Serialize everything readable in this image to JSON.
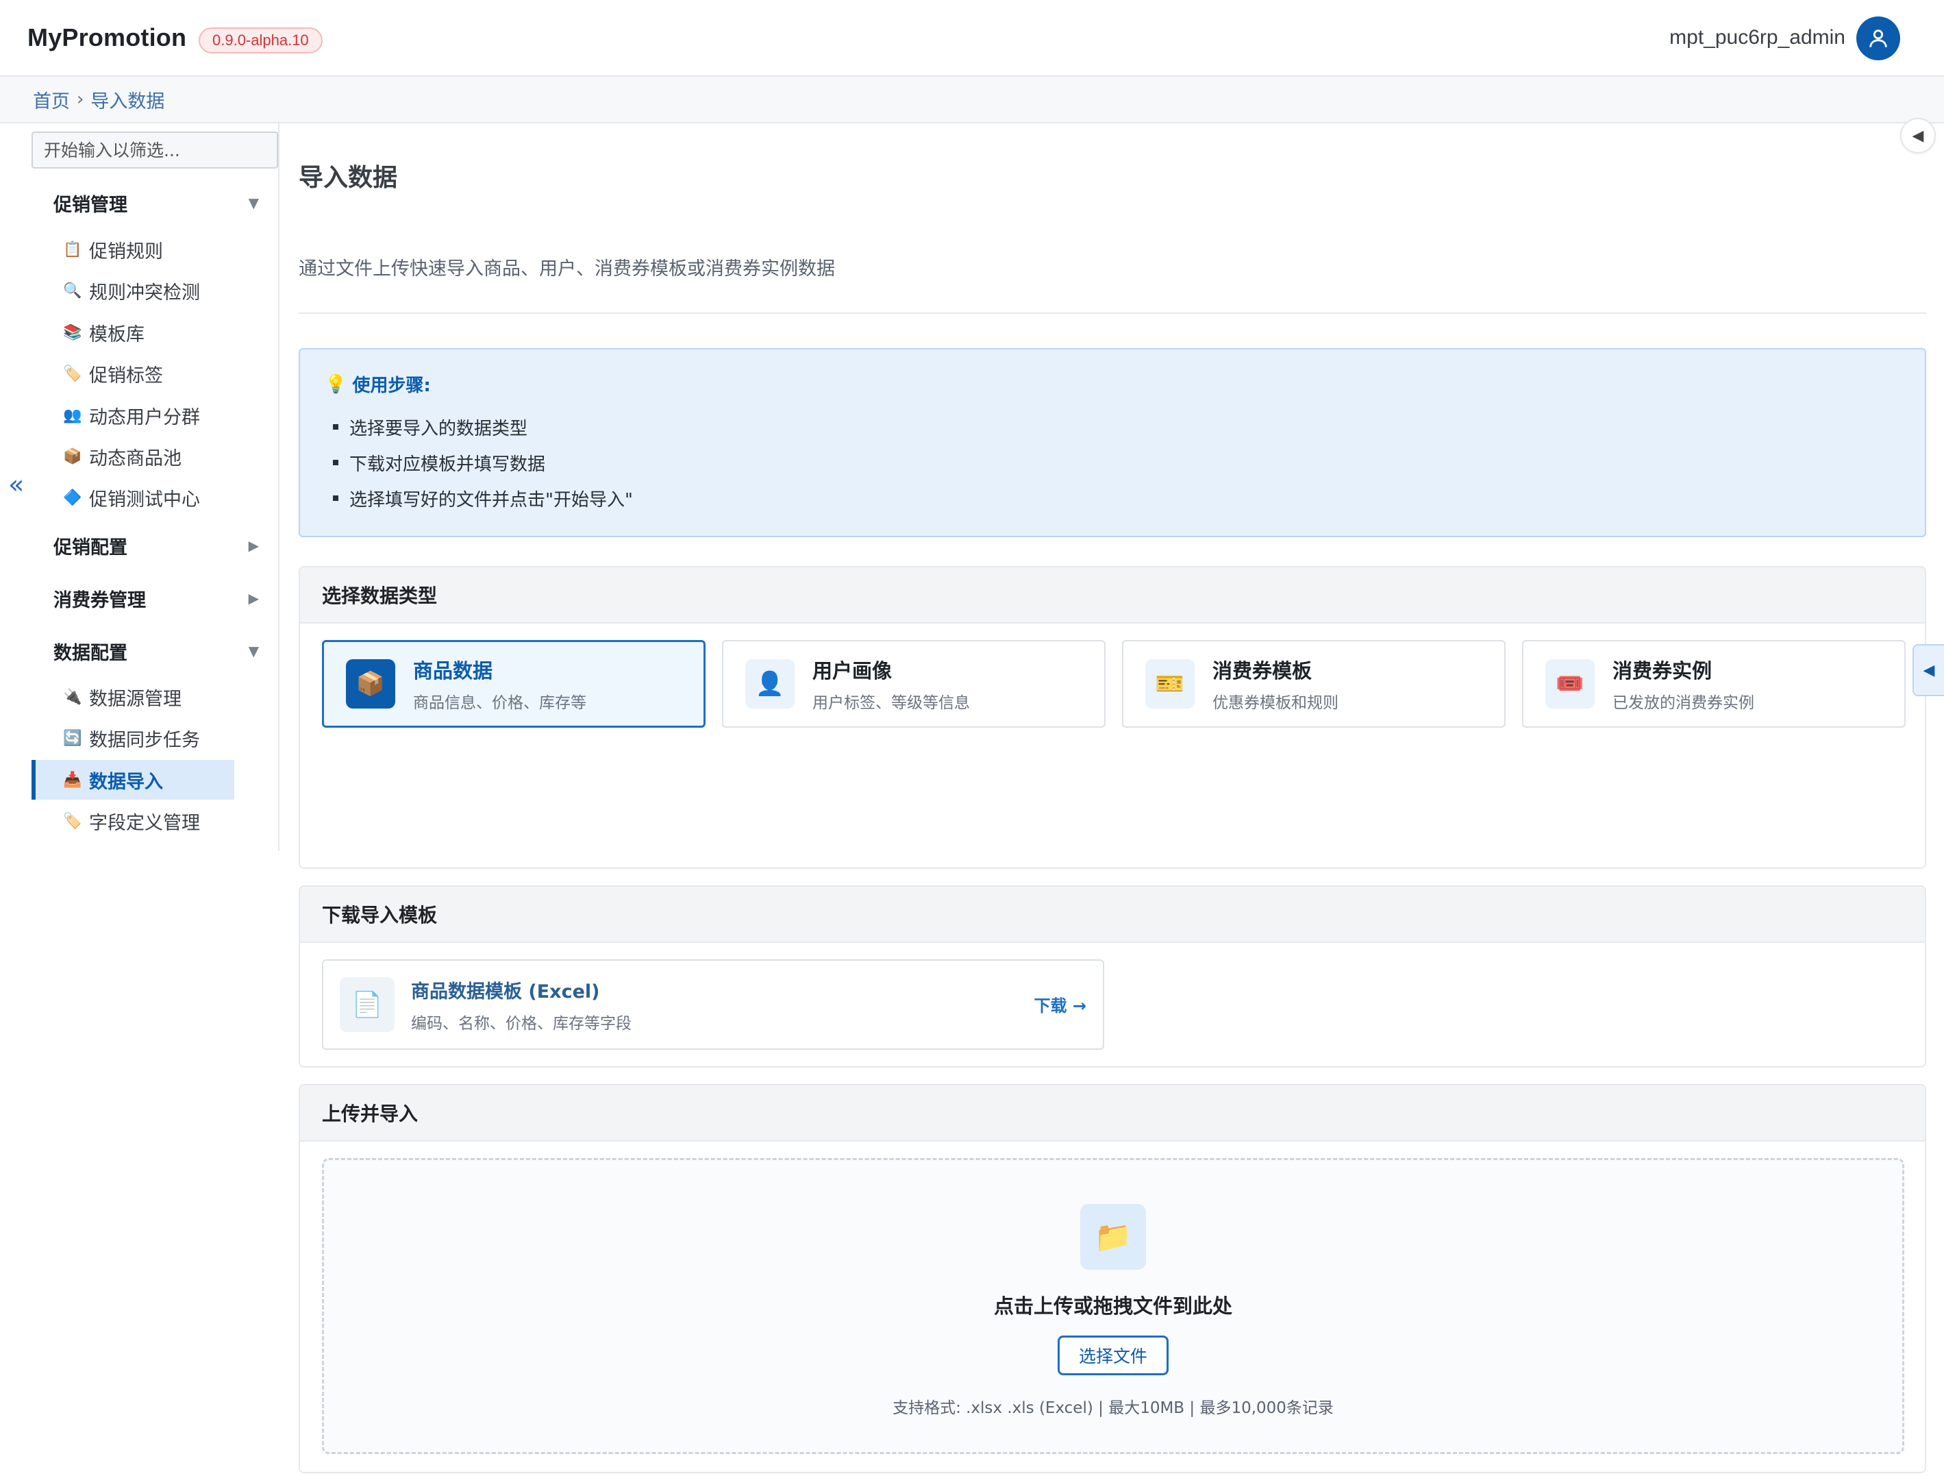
{
  "app": {
    "brand": "MyPromotion",
    "version": "0.9.0-alpha.10",
    "username": "mpt_puc6rp_admin"
  },
  "breadcrumb": {
    "home": "首页",
    "separator": "›",
    "current": "导入数据"
  },
  "sidebar": {
    "filter_placeholder": "开始输入以筛选...",
    "collapse_icon": "«",
    "groups": [
      {
        "title": "促销管理",
        "expanded": true,
        "items": [
          {
            "icon": "📋",
            "label": "促销规则"
          },
          {
            "icon": "🔍",
            "label": "规则冲突检测"
          },
          {
            "icon": "📚",
            "label": "模板库"
          },
          {
            "icon": "🏷️",
            "label": "促销标签"
          },
          {
            "icon": "👥",
            "label": "动态用户分群"
          },
          {
            "icon": "📦",
            "label": "动态商品池"
          },
          {
            "icon": "🔷",
            "label": "促销测试中心"
          }
        ]
      },
      {
        "title": "促销配置",
        "expanded": false,
        "items": []
      },
      {
        "title": "消费券管理",
        "expanded": false,
        "items": []
      },
      {
        "title": "数据配置",
        "expanded": true,
        "items": [
          {
            "icon": "🔌",
            "label": "数据源管理"
          },
          {
            "icon": "🔄",
            "label": "数据同步任务"
          },
          {
            "icon": "📥",
            "label": "数据导入",
            "active": true
          },
          {
            "icon": "🏷️",
            "label": "字段定义管理"
          }
        ]
      }
    ]
  },
  "main": {
    "title": "导入数据",
    "description": "通过文件上传快速导入商品、用户、消费券模板或消费券实例数据",
    "steps": {
      "icon": "💡",
      "title": "使用步骤:",
      "items": [
        "选择要导入的数据类型",
        "下载对应模板并填写数据",
        "选择填写好的文件并点击\"开始导入\""
      ]
    },
    "type_section": {
      "title": "选择数据类型",
      "types": [
        {
          "icon": "📦",
          "name": "商品数据",
          "desc": "商品信息、价格、库存等",
          "selected": true
        },
        {
          "icon": "👤",
          "name": "用户画像",
          "desc": "用户标签、等级等信息"
        },
        {
          "icon": "🎫",
          "name": "消费券模板",
          "desc": "优惠券模板和规则"
        },
        {
          "icon": "🎟️",
          "name": "消费券实例",
          "desc": "已发放的消费券实例"
        }
      ]
    },
    "template_section": {
      "title": "下载导入模板",
      "icon": "📄",
      "name": "商品数据模板 (Excel)",
      "desc": "编码、名称、价格、库存等字段",
      "download_label": "下载 →"
    },
    "upload_section": {
      "title": "上传并导入",
      "icon": "📁",
      "drop_title": "点击上传或拖拽文件到此处",
      "button_label": "选择文件",
      "hint": "支持格式: .xlsx .xls (Excel) | 最大10MB | 最多10,000条记录"
    }
  },
  "colors": {
    "accent": "#0b5cad",
    "info_bg": "#e6f1fc",
    "version_badge": "#d0343a"
  }
}
